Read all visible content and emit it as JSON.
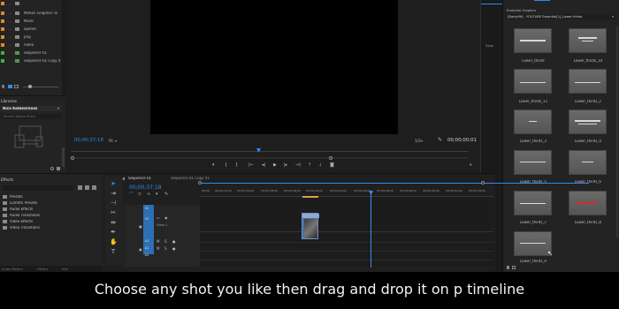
{
  "colors": {
    "accent_blue": "#2d8ceb",
    "orange_label": "#e0882a",
    "green_label": "#3fb43f",
    "playhead": "#3a8fe8",
    "caption_bg": "#000000"
  },
  "project": {
    "items": [
      {
        "label": "",
        "color": "#e0882a",
        "icon": "folder-icon"
      },
      {
        "label": "Motion Graphics Te",
        "color": "#e0882a",
        "icon": "folder-icon"
      },
      {
        "label": "Music",
        "color": "#e0882a",
        "icon": "folder-icon"
      },
      {
        "label": "opener",
        "color": "#e0882a",
        "icon": "folder-icon"
      },
      {
        "label": "png",
        "color": "#e0882a",
        "icon": "folder-icon"
      },
      {
        "label": "Video",
        "color": "#e0882a",
        "icon": "folder-icon"
      },
      {
        "label": "Sequence 01",
        "color": "#3fb43f",
        "icon": "sequence-icon"
      },
      {
        "label": "Sequence 01 Copy 0",
        "color": "#3fb43f",
        "icon": "sequence-icon"
      }
    ]
  },
  "libraries": {
    "title": "Libraries",
    "library_name": "Nico Kolbearnnes",
    "search_placeholder": "Search Adobe Stock"
  },
  "effects": {
    "title": "Effects",
    "items": [
      "Presets",
      "Lumetri Presets",
      "Audio Effects",
      "Audio Transitions",
      "Video Effects",
      "Video Transitions"
    ]
  },
  "program": {
    "timecode_current": "00;00;37;18",
    "fit": "Fit",
    "resolution": "1/2",
    "timecode_duration": "00;00;00;01"
  },
  "sidebar_strip": {
    "label": "Sequ"
  },
  "essential_graphics": {
    "title": "Essential Graphics",
    "browse_path": "[Daisyfilt] - YOUTUBE Essential[1]_Lower thirds",
    "items": [
      "Lower_thirds",
      "Lower_thirds_10",
      "Lower_thirds_11",
      "Lower_thirds_2",
      "Lower_thirds_3",
      "Lower_thirds_4",
      "Lower_thirds_5",
      "Lower_thirds_6",
      "Lower_thirds_7",
      "Lower_thirds_8",
      "Lower_thirds_9"
    ]
  },
  "timeline": {
    "tabs": [
      "Sequence 01",
      "Sequence 01 Copy 01"
    ],
    "timecode": "00;00;37;18",
    "ruler": [
      "00;00",
      "00;00;32;00",
      "00;00;34;00",
      "00;00;36;00",
      "00;00;38;00",
      "00;00;40;00",
      "00;00;42;00",
      "00;00;44;00",
      "00;00;46;00",
      "00;00;48;00",
      "00;00;50;00",
      "00;00;52;00",
      "00;00;54;00"
    ],
    "video_tracks": [
      "V2",
      "V1"
    ],
    "audio_tracks": [
      "A1",
      "A2",
      "A3"
    ],
    "video_track_name": "Video 1"
  },
  "bottom_tabs": [
    "Audio Meters",
    "History",
    "Info"
  ],
  "caption": "Choose any shot you like then drag and drop it on p timeline"
}
